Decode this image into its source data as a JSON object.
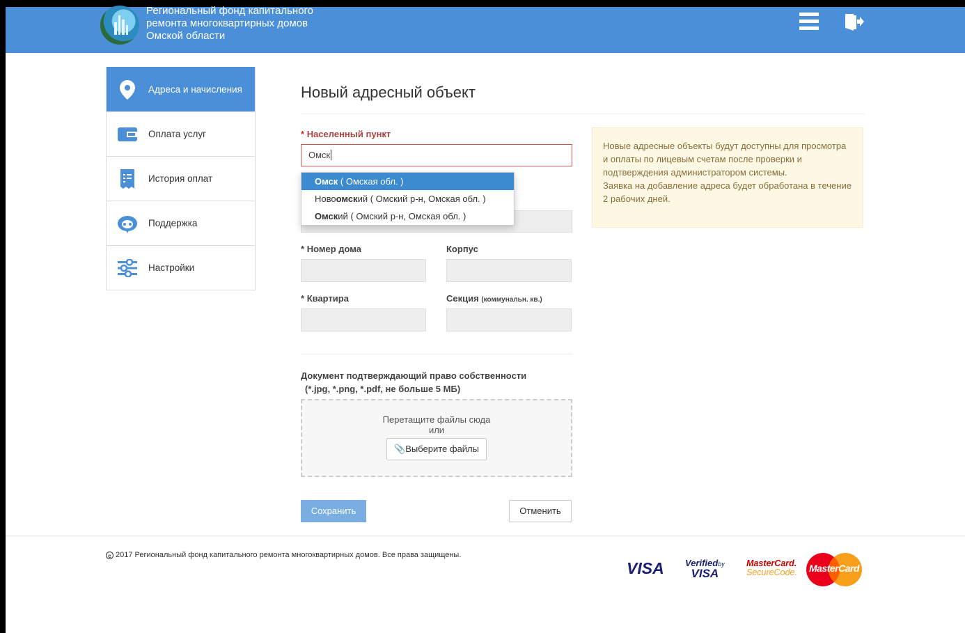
{
  "header": {
    "org_title_lines": [
      "Региональный фонд капитального",
      "ремонта многоквартирных домов",
      "Омской области"
    ],
    "menu_icon": "hamburger-menu-icon",
    "exit_icon": "exit-door-icon",
    "color": "#4a8fd8"
  },
  "sidebar": {
    "items": [
      {
        "label": "Адреса и начисления",
        "icon": "map-pin-icon",
        "active": true
      },
      {
        "label": "Оплата услуг",
        "icon": "wallet-icon",
        "active": false
      },
      {
        "label": "История оплат",
        "icon": "receipt-icon",
        "active": false
      },
      {
        "label": "Поддержка",
        "icon": "support-headset-icon",
        "active": false
      },
      {
        "label": "Настройки",
        "icon": "settings-sliders-icon",
        "active": false
      }
    ]
  },
  "form": {
    "title": "Новый адресный объект",
    "required_mark": "*",
    "city_label": "Населенный пункт",
    "city_value": "Омск",
    "suggestions": [
      {
        "match": "Омск",
        "prefix": "",
        "suffix": "",
        "detail": " ( Омская обл. )",
        "selected": true
      },
      {
        "prefix": "Ново",
        "match": "омск",
        "suffix": "ий",
        "detail": " ( Омский р-н,  Омская обл. )",
        "selected": false
      },
      {
        "prefix": "",
        "match": "Омск",
        "suffix": "ий",
        "detail": " ( Омский р-н,  Омская обл. )",
        "selected": false
      }
    ],
    "house_label": "Номер дома",
    "korpus_label": "Корпус",
    "apartment_label": "Квартира",
    "section_label": "Секция",
    "section_hint": "(коммунальн. кв.)",
    "document_label_line1": "Документ подтверждающий право собственности",
    "document_label_line2": "(*.jpg, *.png, *.pdf, не больше 5 МБ)",
    "dropzone_text": "Перетащите файлы сюда",
    "dropzone_or": "или",
    "choose_files_label": "Выберите файлы",
    "save_label": "Сохранить",
    "cancel_label": "Отменить"
  },
  "notice": {
    "text_line1": "Новые адресные объекты будут доступны для просмотра и оплаты по лицевым счетам после проверки и подтверждения администратором системы.",
    "text_line2": "Заявка на добавление адреса будет обработана в течение 2 рабочих дней."
  },
  "footer": {
    "copyright_symbol": "c",
    "copyright": "2017 Региональный фонд капитального ремонта многоквартирных домов. Все права защищены.",
    "payment_logos": {
      "visa": "VISA",
      "verified_top": "Verified",
      "verified_by": "by",
      "verified_visa": "VISA",
      "mc_securecode_1": "MasterCard.",
      "mc_securecode_2": "SecureCode.",
      "mastercard": "MasterCard"
    }
  }
}
